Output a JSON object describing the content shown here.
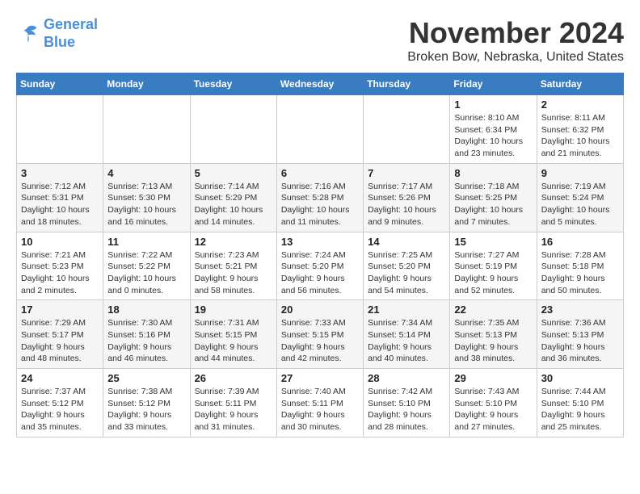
{
  "header": {
    "logo_line1": "General",
    "logo_line2": "Blue",
    "month": "November 2024",
    "location": "Broken Bow, Nebraska, United States"
  },
  "weekdays": [
    "Sunday",
    "Monday",
    "Tuesday",
    "Wednesday",
    "Thursday",
    "Friday",
    "Saturday"
  ],
  "weeks": [
    [
      {
        "day": "",
        "info": ""
      },
      {
        "day": "",
        "info": ""
      },
      {
        "day": "",
        "info": ""
      },
      {
        "day": "",
        "info": ""
      },
      {
        "day": "",
        "info": ""
      },
      {
        "day": "1",
        "info": "Sunrise: 8:10 AM\nSunset: 6:34 PM\nDaylight: 10 hours and 23 minutes."
      },
      {
        "day": "2",
        "info": "Sunrise: 8:11 AM\nSunset: 6:32 PM\nDaylight: 10 hours and 21 minutes."
      }
    ],
    [
      {
        "day": "3",
        "info": "Sunrise: 7:12 AM\nSunset: 5:31 PM\nDaylight: 10 hours and 18 minutes."
      },
      {
        "day": "4",
        "info": "Sunrise: 7:13 AM\nSunset: 5:30 PM\nDaylight: 10 hours and 16 minutes."
      },
      {
        "day": "5",
        "info": "Sunrise: 7:14 AM\nSunset: 5:29 PM\nDaylight: 10 hours and 14 minutes."
      },
      {
        "day": "6",
        "info": "Sunrise: 7:16 AM\nSunset: 5:28 PM\nDaylight: 10 hours and 11 minutes."
      },
      {
        "day": "7",
        "info": "Sunrise: 7:17 AM\nSunset: 5:26 PM\nDaylight: 10 hours and 9 minutes."
      },
      {
        "day": "8",
        "info": "Sunrise: 7:18 AM\nSunset: 5:25 PM\nDaylight: 10 hours and 7 minutes."
      },
      {
        "day": "9",
        "info": "Sunrise: 7:19 AM\nSunset: 5:24 PM\nDaylight: 10 hours and 5 minutes."
      }
    ],
    [
      {
        "day": "10",
        "info": "Sunrise: 7:21 AM\nSunset: 5:23 PM\nDaylight: 10 hours and 2 minutes."
      },
      {
        "day": "11",
        "info": "Sunrise: 7:22 AM\nSunset: 5:22 PM\nDaylight: 10 hours and 0 minutes."
      },
      {
        "day": "12",
        "info": "Sunrise: 7:23 AM\nSunset: 5:21 PM\nDaylight: 9 hours and 58 minutes."
      },
      {
        "day": "13",
        "info": "Sunrise: 7:24 AM\nSunset: 5:20 PM\nDaylight: 9 hours and 56 minutes."
      },
      {
        "day": "14",
        "info": "Sunrise: 7:25 AM\nSunset: 5:20 PM\nDaylight: 9 hours and 54 minutes."
      },
      {
        "day": "15",
        "info": "Sunrise: 7:27 AM\nSunset: 5:19 PM\nDaylight: 9 hours and 52 minutes."
      },
      {
        "day": "16",
        "info": "Sunrise: 7:28 AM\nSunset: 5:18 PM\nDaylight: 9 hours and 50 minutes."
      }
    ],
    [
      {
        "day": "17",
        "info": "Sunrise: 7:29 AM\nSunset: 5:17 PM\nDaylight: 9 hours and 48 minutes."
      },
      {
        "day": "18",
        "info": "Sunrise: 7:30 AM\nSunset: 5:16 PM\nDaylight: 9 hours and 46 minutes."
      },
      {
        "day": "19",
        "info": "Sunrise: 7:31 AM\nSunset: 5:15 PM\nDaylight: 9 hours and 44 minutes."
      },
      {
        "day": "20",
        "info": "Sunrise: 7:33 AM\nSunset: 5:15 PM\nDaylight: 9 hours and 42 minutes."
      },
      {
        "day": "21",
        "info": "Sunrise: 7:34 AM\nSunset: 5:14 PM\nDaylight: 9 hours and 40 minutes."
      },
      {
        "day": "22",
        "info": "Sunrise: 7:35 AM\nSunset: 5:13 PM\nDaylight: 9 hours and 38 minutes."
      },
      {
        "day": "23",
        "info": "Sunrise: 7:36 AM\nSunset: 5:13 PM\nDaylight: 9 hours and 36 minutes."
      }
    ],
    [
      {
        "day": "24",
        "info": "Sunrise: 7:37 AM\nSunset: 5:12 PM\nDaylight: 9 hours and 35 minutes."
      },
      {
        "day": "25",
        "info": "Sunrise: 7:38 AM\nSunset: 5:12 PM\nDaylight: 9 hours and 33 minutes."
      },
      {
        "day": "26",
        "info": "Sunrise: 7:39 AM\nSunset: 5:11 PM\nDaylight: 9 hours and 31 minutes."
      },
      {
        "day": "27",
        "info": "Sunrise: 7:40 AM\nSunset: 5:11 PM\nDaylight: 9 hours and 30 minutes."
      },
      {
        "day": "28",
        "info": "Sunrise: 7:42 AM\nSunset: 5:10 PM\nDaylight: 9 hours and 28 minutes."
      },
      {
        "day": "29",
        "info": "Sunrise: 7:43 AM\nSunset: 5:10 PM\nDaylight: 9 hours and 27 minutes."
      },
      {
        "day": "30",
        "info": "Sunrise: 7:44 AM\nSunset: 5:10 PM\nDaylight: 9 hours and 25 minutes."
      }
    ]
  ]
}
